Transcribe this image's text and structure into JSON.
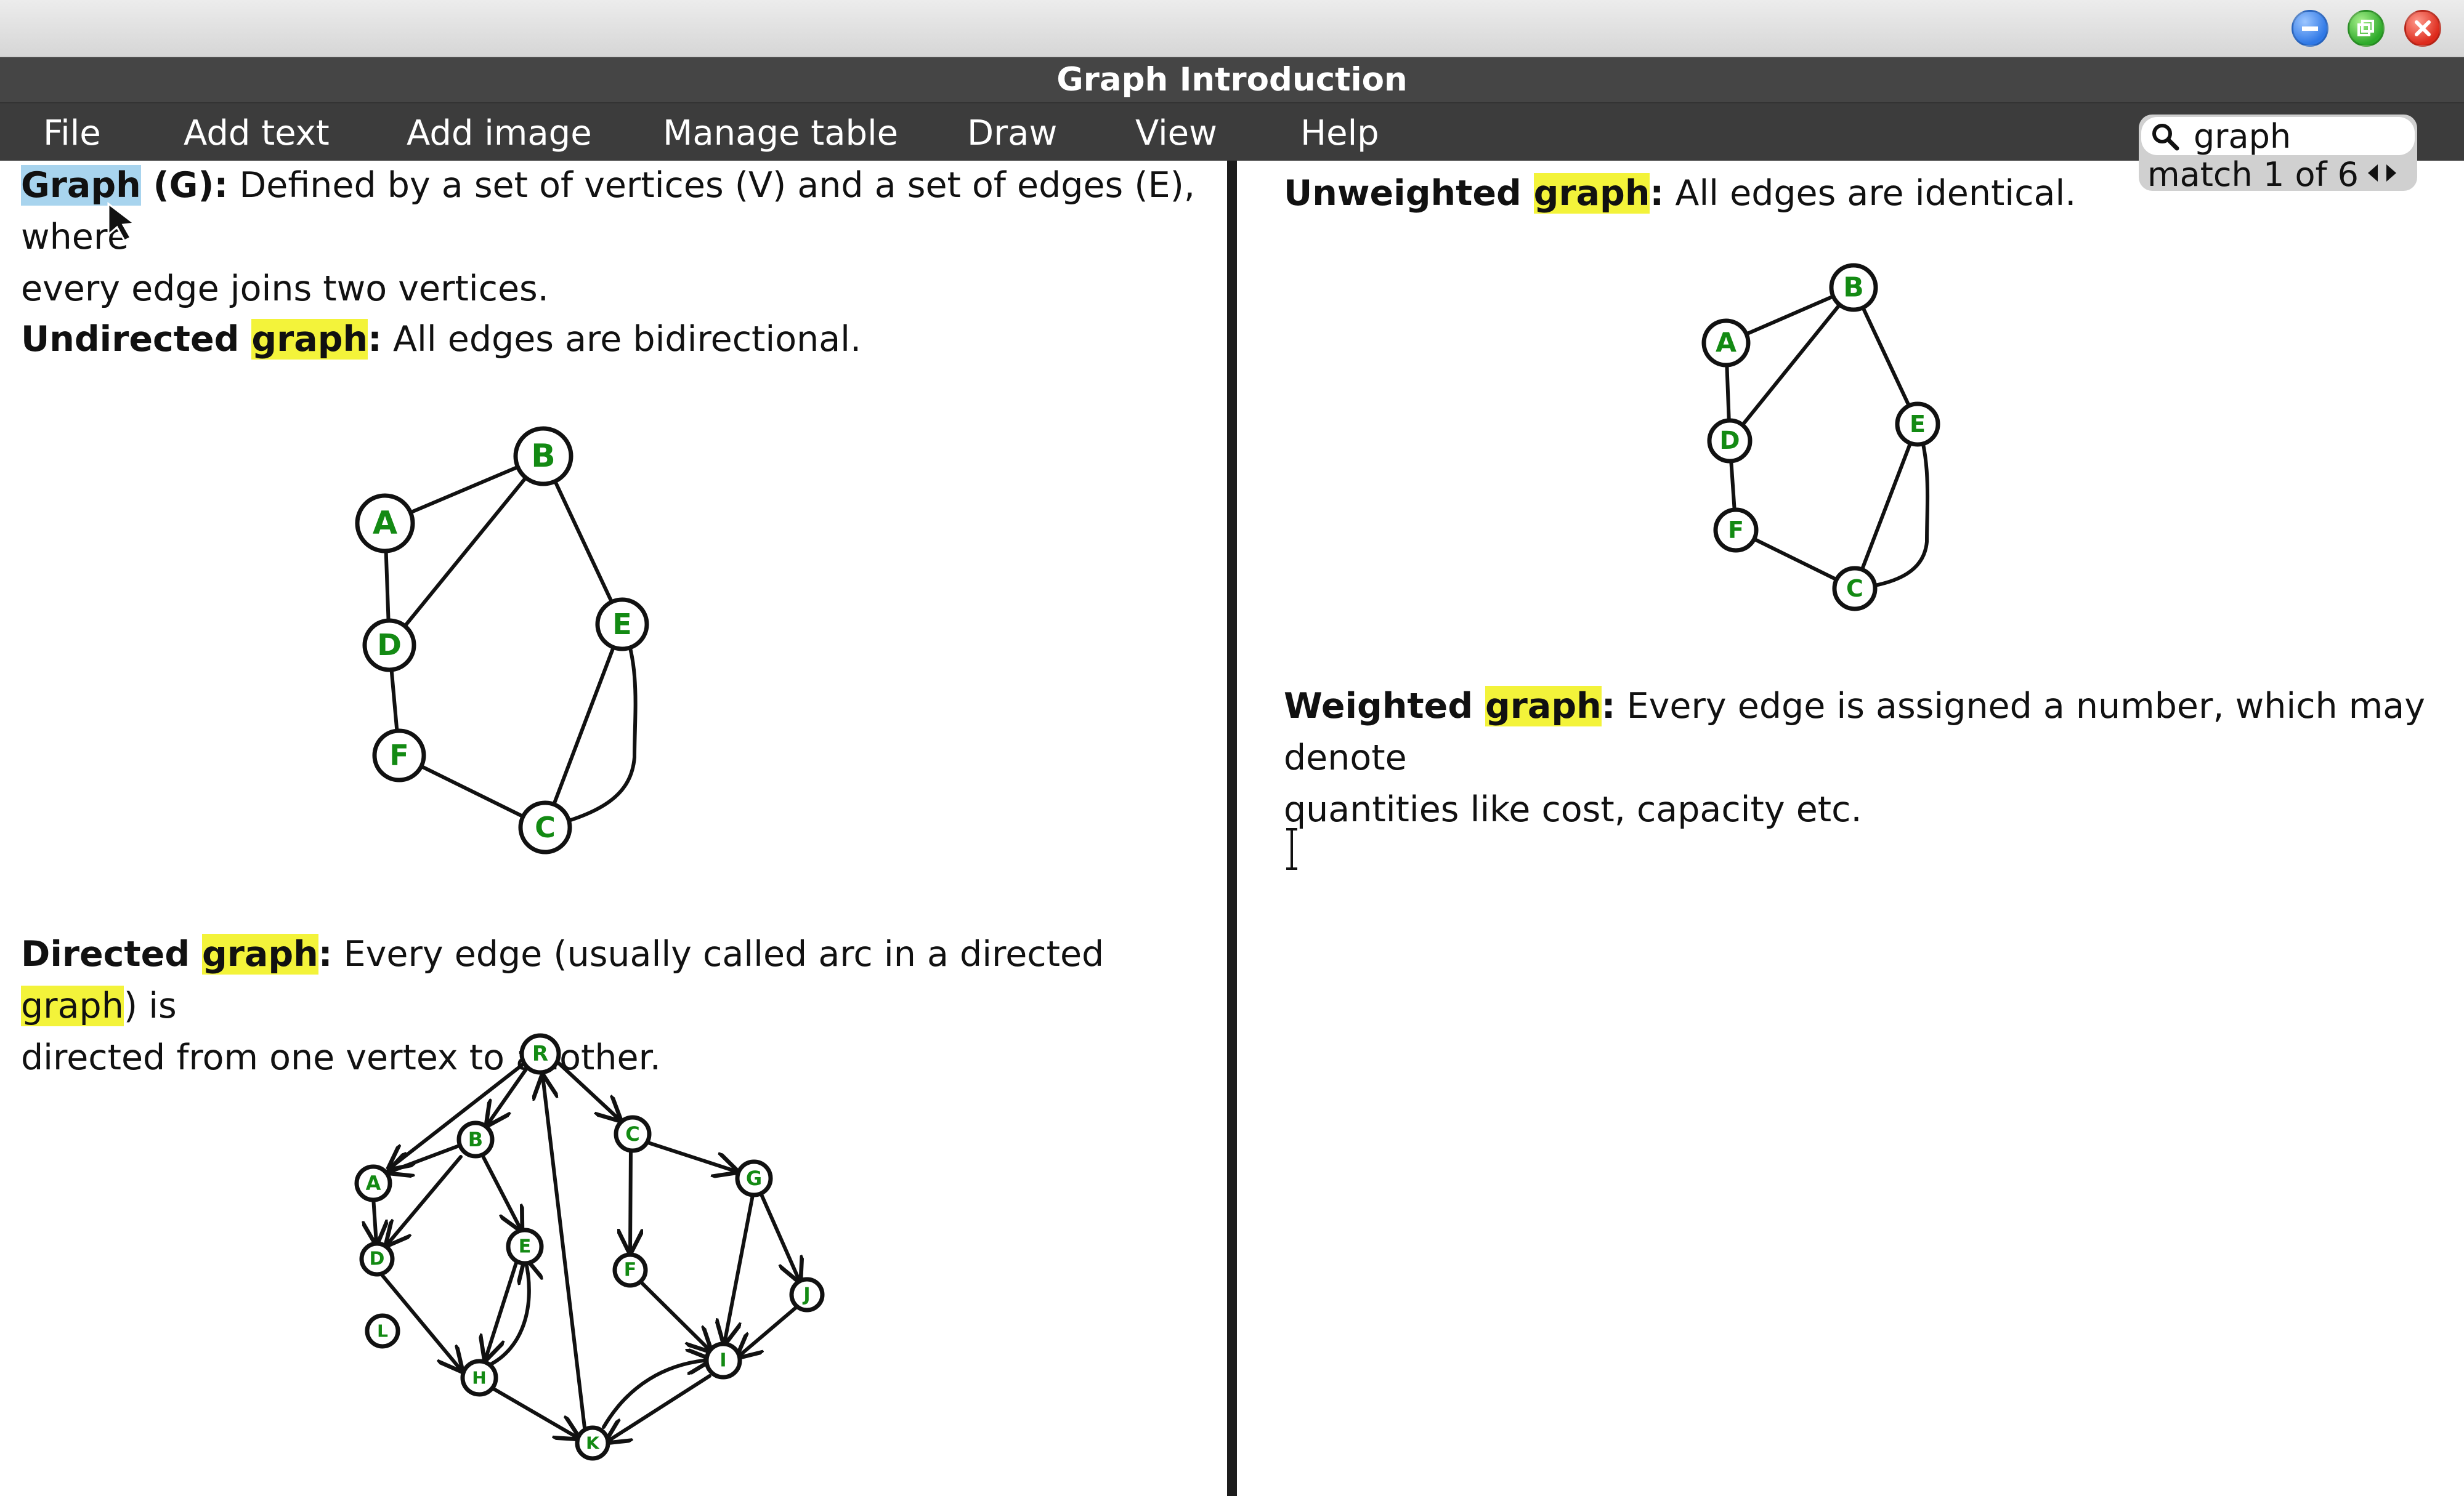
{
  "app": {
    "title": "Graph Introduction"
  },
  "menu": [
    "File",
    "Add text",
    "Add image",
    "Manage table",
    "Draw",
    "View",
    "Help"
  ],
  "search": {
    "query": "graph",
    "match_status": "match 1 of 6"
  },
  "left": {
    "p1": {
      "term": "Graph",
      "suffix": " (G):",
      "line1": " Defined by a set of vertices (V) and a set of edges (E), where",
      "line2": "every edge joins two vertices."
    },
    "p2": {
      "prefix": "Undirected ",
      "term": "graph",
      "colon": ":",
      "text": " All edges are bidirectional."
    },
    "p3": {
      "prefix": "Directed ",
      "term": "graph",
      "colon": ":",
      "text1": " Every edge (usually called arc in a directed ",
      "term2": "graph",
      "text2": ") is",
      "line2": "directed from one vertex to another."
    }
  },
  "right": {
    "p1": {
      "prefix": "Unweighted ",
      "term": "graph",
      "colon": ":",
      "text": " All edges are identical."
    },
    "p2": {
      "prefix": "Weighted ",
      "term": "graph",
      "colon": ":",
      "text": " Every edge is assigned a number, which may denote",
      "line2": "quantities like cost, capacity etc."
    }
  },
  "undirected_nodes": [
    "A",
    "B",
    "D",
    "E",
    "F",
    "C"
  ],
  "directed_nodes": [
    "R",
    "A",
    "B",
    "C",
    "G",
    "D",
    "E",
    "F",
    "J",
    "L",
    "H",
    "I",
    "K"
  ],
  "colors": {
    "highlight": "#f3f33a",
    "active_highlight": "#a8d4ee",
    "node_label": "#138a13",
    "title_bar": "#454545",
    "menu_bar": "#3c3c3c"
  }
}
